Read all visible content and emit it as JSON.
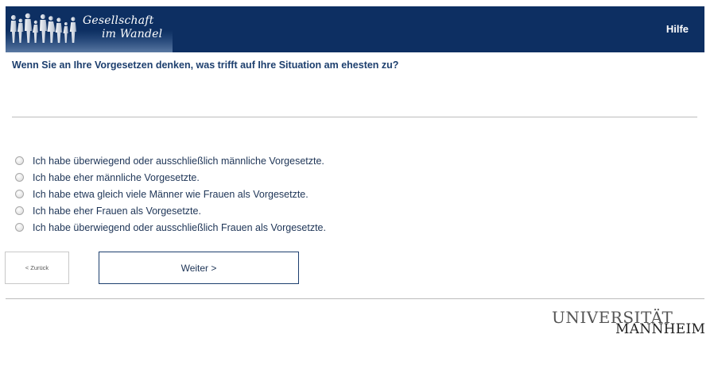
{
  "header": {
    "logo_line1": "Gesellschaft",
    "logo_line2": "im Wandel",
    "help_label": "Hilfe",
    "background_color": "#0d2f62"
  },
  "question": {
    "text": "Wenn Sie an Ihre Vorgesetzen denken, was trifft auf Ihre Situation am ehesten zu?"
  },
  "options": [
    {
      "label": "Ich habe überwiegend oder ausschließlich männliche Vorgesetzte.",
      "selected": false
    },
    {
      "label": "Ich habe eher männliche Vorgesetzte.",
      "selected": false
    },
    {
      "label": "Ich habe etwa gleich viele Männer wie Frauen als Vorgesetzte.",
      "selected": false
    },
    {
      "label": "Ich habe eher Frauen als Vorgesetzte.",
      "selected": false
    },
    {
      "label": "Ich habe überwiegend oder ausschließlich Frauen als Vorgesetzte.",
      "selected": false
    }
  ],
  "navigation": {
    "back_label": "< Zurück",
    "next_label": "Weiter >"
  },
  "footer": {
    "university_line1": "UNIVERSITÄT",
    "university_line2": "MANNHEIM"
  }
}
